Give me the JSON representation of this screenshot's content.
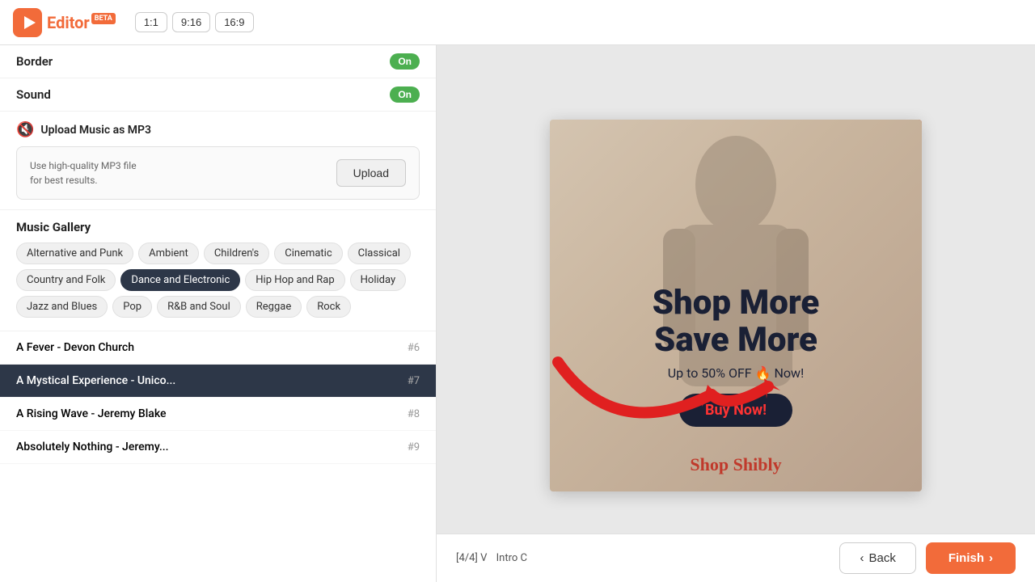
{
  "header": {
    "logo_text": "Editor",
    "beta": "BETA",
    "ratios": [
      "1:1",
      "9:16",
      "16:9"
    ]
  },
  "left_panel": {
    "border_label": "Border",
    "border_toggle": "On",
    "sound_label": "Sound",
    "sound_toggle": "On",
    "upload_title": "Upload Music as MP3",
    "upload_desc_line1": "Use high-quality MP3 file",
    "upload_desc_line2": "for best results.",
    "upload_btn": "Upload",
    "gallery_title": "Music Gallery",
    "genres": [
      {
        "label": "Alternative and Punk",
        "active": false
      },
      {
        "label": "Ambient",
        "active": false
      },
      {
        "label": "Children's",
        "active": false
      },
      {
        "label": "Cinematic",
        "active": false
      },
      {
        "label": "Classical",
        "active": false
      },
      {
        "label": "Country and Folk",
        "active": false
      },
      {
        "label": "Dance and Electronic",
        "active": true
      },
      {
        "label": "Hip Hop and Rap",
        "active": false
      },
      {
        "label": "Holiday",
        "active": false
      },
      {
        "label": "Jazz and Blues",
        "active": false
      },
      {
        "label": "Pop",
        "active": false
      },
      {
        "label": "R&B and Soul",
        "active": false
      },
      {
        "label": "Reggae",
        "active": false
      },
      {
        "label": "Rock",
        "active": false
      }
    ],
    "tracks": [
      {
        "name": "A Fever - Devon Church",
        "num": "#6",
        "active": false
      },
      {
        "name": "A Mystical Experience - Unico...",
        "num": "#7",
        "active": true
      },
      {
        "name": "A Rising Wave - Jeremy Blake",
        "num": "#8",
        "active": false
      },
      {
        "name": "Absolutely Nothing - Jeremy...",
        "num": "#9",
        "active": false
      }
    ]
  },
  "canvas": {
    "ad_headline": "Shop More\nSave More",
    "ad_subtext": "Up to 50% OFF 🔥 Now!",
    "ad_cta": "Buy Now!"
  },
  "bottom": {
    "status": "[4/4] V",
    "status2": "Intro C",
    "back_btn": "Back",
    "finish_btn": "Finish"
  }
}
